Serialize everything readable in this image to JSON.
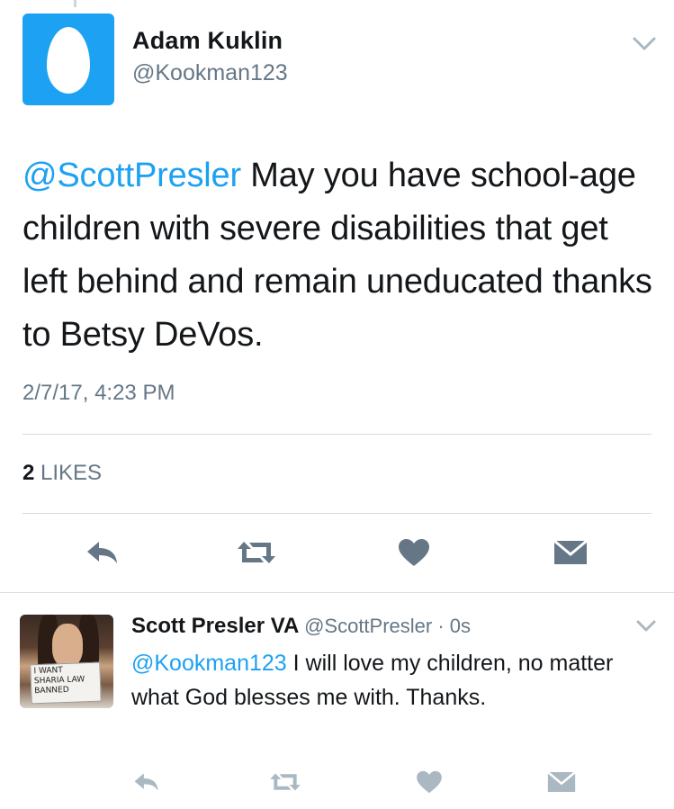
{
  "main_tweet": {
    "author_name": "Adam Kuklin",
    "author_handle": "@Kookman123",
    "mention": "@ScottPresler",
    "body": " May you have school-age children with severe disabilities that get left behind and remain uneducated thanks to Betsy DeVos.",
    "timestamp": "2/7/17, 4:23 PM",
    "likes_count": "2",
    "likes_label": " LIKES"
  },
  "reply_tweet": {
    "author_name": "Scott Presler VA",
    "author_handle": "@ScottPresler",
    "time_separator": " · ",
    "time_ago": "0s",
    "mention": "@Kookman123",
    "body": " I will love my children, no matter what God blesses me with. Thanks.",
    "avatar_sign_lines": [
      "I WANT",
      "SHARIA LAW",
      "BANNED"
    ]
  },
  "icons": {
    "menu": "chevron-down-icon",
    "reply": "reply-icon",
    "retweet": "retweet-icon",
    "like": "heart-icon",
    "dm": "envelope-icon"
  },
  "colors": {
    "accent": "#1da1f2",
    "secondary_text": "#657786",
    "icon": "#657786"
  }
}
